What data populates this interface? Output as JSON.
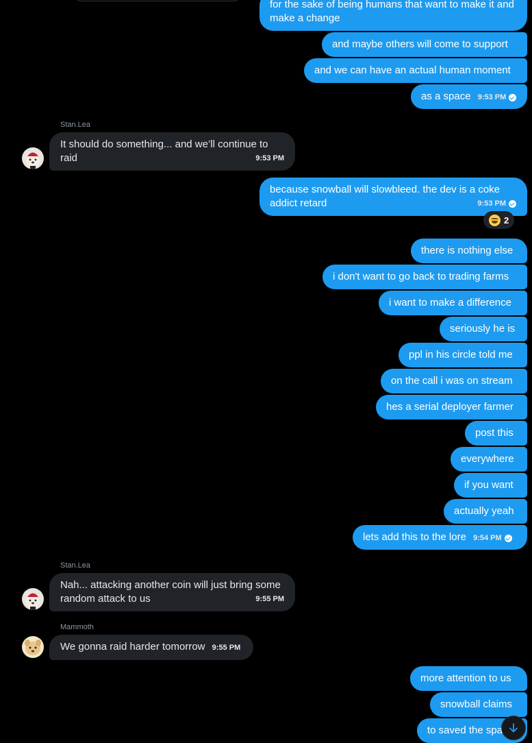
{
  "colors": {
    "outgoing": "#1d9bf0",
    "incoming": "#202327",
    "background": "#000000"
  },
  "messages": {
    "m0": {
      "text": "for the sake of being humans that want to make it and make a change"
    },
    "m1": {
      "text": "and maybe others will come to support"
    },
    "m2": {
      "text": "and we can have an actual human moment"
    },
    "m3": {
      "text": "as a space",
      "time": "9:53 PM"
    },
    "s1": {
      "sender": "Stan.Lea",
      "text": "It should do something... and we’ll continue to raid",
      "time": "9:53 PM"
    },
    "m4": {
      "text": "because snowball will slowbleed. the dev is a coke addict retard",
      "time": "9:53 PM",
      "reaction_count": "2"
    },
    "m5": {
      "text": "there is nothing else"
    },
    "m6": {
      "text": "i don't want to go back to trading farms"
    },
    "m7": {
      "text": "i want to make a difference"
    },
    "m8": {
      "text": "seriously he is"
    },
    "m9": {
      "text": "ppl in his circle told me"
    },
    "m10": {
      "text": "on the call i was on stream"
    },
    "m11": {
      "text": "hes a serial deployer farmer"
    },
    "m12": {
      "text": "post this"
    },
    "m13": {
      "text": "everywhere"
    },
    "m14": {
      "text": "if you want"
    },
    "m15": {
      "text": "actually yeah"
    },
    "m16": {
      "text": "lets add this to the lore",
      "time": "9:54 PM"
    },
    "s2": {
      "sender": "Stan.Lea",
      "text": "Nah... attacking another coin will just bring some random attack to us",
      "time": "9:55 PM"
    },
    "s3": {
      "sender": "Mammoth",
      "text": "We gonna raid harder tomorrow",
      "time": "9:55 PM"
    },
    "m17": {
      "text": "more attention to us"
    },
    "m18": {
      "text": "snowball claims"
    },
    "m19": {
      "text": "to saved the spa"
    }
  },
  "icons": {
    "read_receipt": "check-circle-icon",
    "reaction": "joy-emoji-icon",
    "scroll": "arrow-down-icon"
  }
}
